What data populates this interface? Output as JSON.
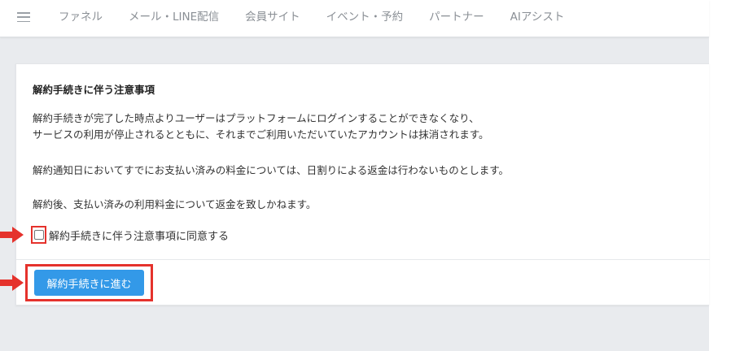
{
  "nav": {
    "items": [
      "ファネル",
      "メール・LINE配信",
      "会員サイト",
      "イベント・予約",
      "パートナー",
      "AIアシスト"
    ]
  },
  "notice": {
    "title": "解約手続きに伴う注意事項",
    "paragraphs": [
      "解約手続きが完了した時点よりユーザーはプラットフォームにログインすることができなくなり、",
      "サービスの利用が停止されるとともに、それまでご利用いただいていたアカウントは抹消されます。",
      "解約通知日においてすでにお支払い済みの料金については、日割りによる返金は行わないものとします。",
      "解約後、支払い済みの利用料金について返金を致しかねます。"
    ],
    "agree_label": "解約手続きに伴う注意事項に同意する",
    "agree_checked": false,
    "submit_label": "解約手続きに進む"
  },
  "colors": {
    "accent_button": "#3399e8",
    "highlight": "#e5322c",
    "page_background": "#e9ebee"
  },
  "icons": [
    "hamburger-menu-icon",
    "red-arrow-icon",
    "red-arrow-icon"
  ]
}
